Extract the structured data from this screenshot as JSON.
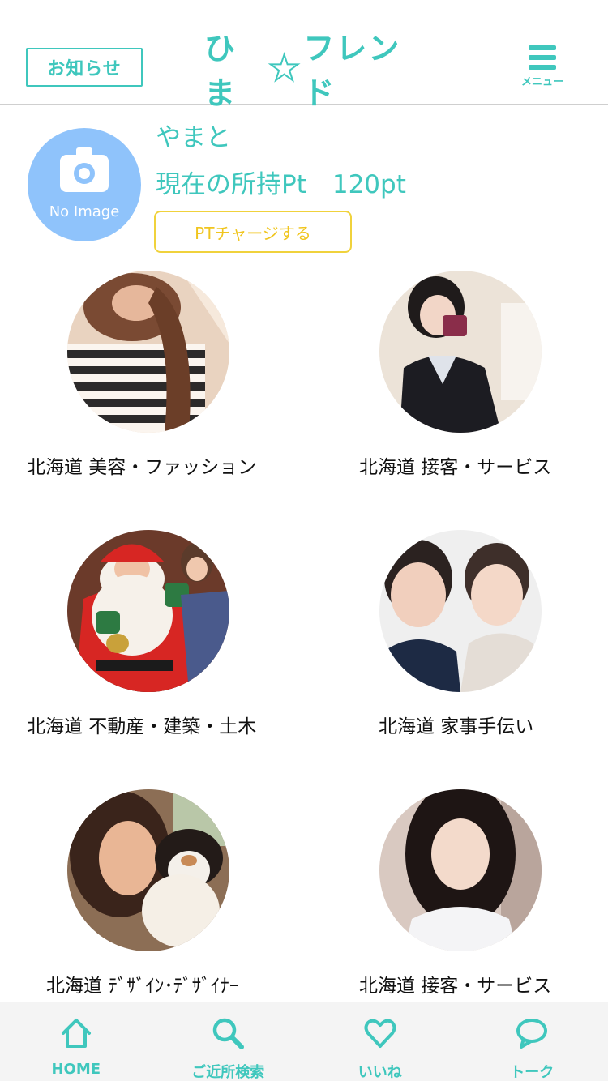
{
  "header": {
    "notice_label": "お知らせ",
    "logo_part1": "ひま",
    "logo_part2": "フレンド",
    "menu_label": "メニュー"
  },
  "profile": {
    "avatar_text": "No Image",
    "name": "やまと",
    "points_label": "現在の所持Pt",
    "points_value": "120pt",
    "charge_label": "PTチャージする"
  },
  "friends": [
    {
      "caption": "北海道 美容・ファッション"
    },
    {
      "caption": "北海道 接客・サービス"
    },
    {
      "caption": "北海道 不動産・建築・土木"
    },
    {
      "caption": "北海道 家事手伝い"
    },
    {
      "caption": "北海道 ﾃﾞｻﾞｲﾝ･ﾃﾞｻﾞｲﾅｰ"
    },
    {
      "caption": "北海道 接客・サービス"
    }
  ],
  "tabbar": {
    "home": "HOME",
    "search": "ご近所検索",
    "like": "いいね",
    "talk": "トーク"
  },
  "colors": {
    "accent": "#3fc7bd",
    "avatar_bg": "#8fc3fb",
    "charge": "#f0c51e"
  },
  "icons": [
    "menu-icon",
    "camera-icon",
    "home-icon",
    "search-icon",
    "heart-icon",
    "speech-bubble-icon"
  ]
}
